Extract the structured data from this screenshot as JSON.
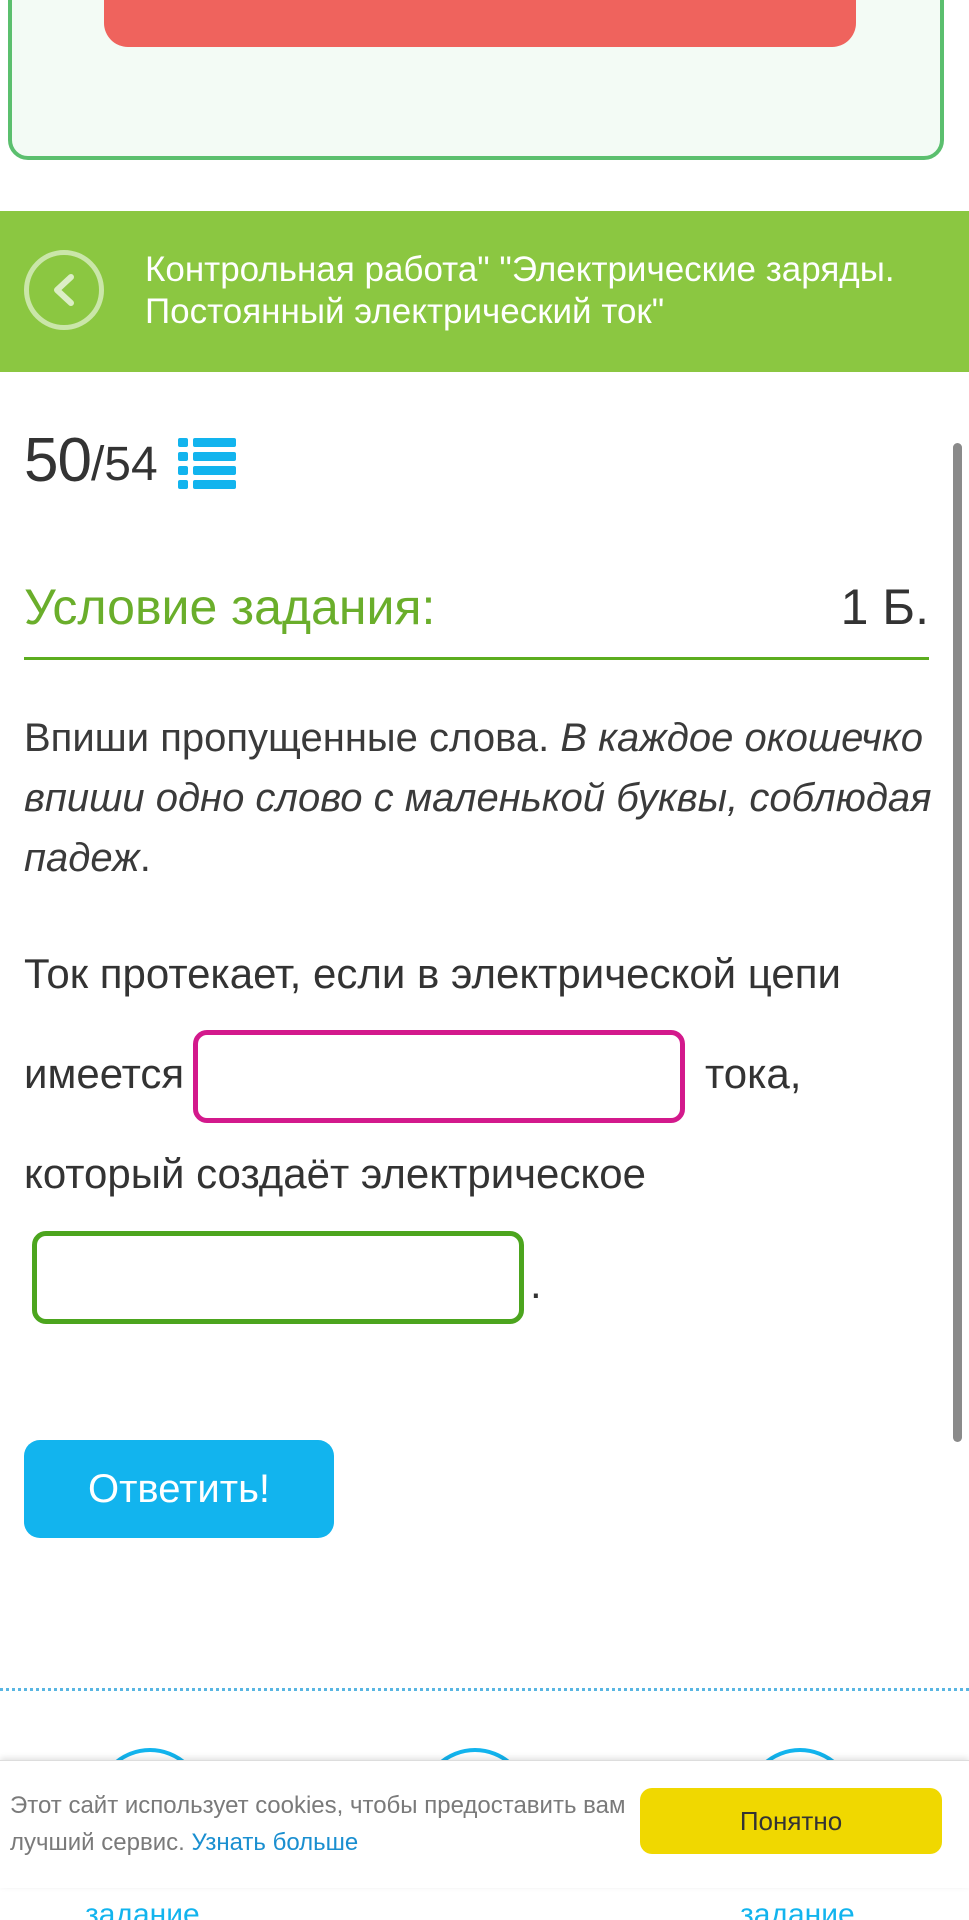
{
  "header": {
    "title_line1": "Контрольная работа\" \"Электрические заряды.",
    "title_line2": "Постоянный электрический ток\""
  },
  "progress": {
    "current": "50",
    "total": "/54"
  },
  "task": {
    "title": "Условие задания:",
    "points": "1 Б."
  },
  "instructions": {
    "plain": "Впиши пропущенные слова. ",
    "italic": "В каждое окошечко впиши одно слово с маленькой буквы, соблюдая падеж",
    "end": "."
  },
  "exercise": {
    "line1": "Ток протекает, если в электрической цепи",
    "before_box1": "имеется",
    "after_box1": "тока,",
    "line3": "который создаёт электрическое",
    "after_box2": ".",
    "box1_value": "",
    "box2_value": ""
  },
  "submit": {
    "label": "Ответить!"
  },
  "cookie": {
    "text": "Этот сайт использует cookies, чтобы предоставить вам лучший сервис. ",
    "link": "Узнать больше",
    "button": "Понятно"
  },
  "bottom_nav": {
    "left_label": "задание",
    "right_label": "задание"
  },
  "colors": {
    "header_bg": "#8bc741",
    "accent_green": "#6aae2b",
    "submit_blue": "#12b4ee",
    "box1_border": "#d3198c",
    "box2_border": "#4ca51e",
    "cookie_button": "#f0d800",
    "top_button": "#ef635d"
  },
  "icons": {
    "back": "chevron-left-icon",
    "task_list": "list-icon"
  }
}
